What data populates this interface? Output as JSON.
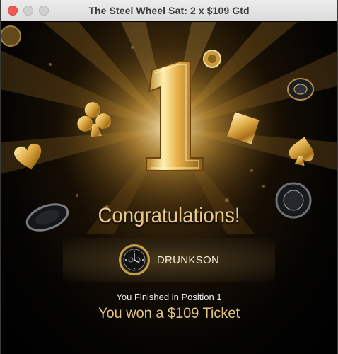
{
  "window": {
    "title": "The Steel Wheel Sat: 2 x $109 Gtd"
  },
  "award": {
    "position_badge": "1",
    "congrats_text": "Congratulations!",
    "player_name": "DRUNKSON",
    "finished_text": "You Finished in Position 1",
    "prize_text": "You won a $109 Ticket"
  },
  "colors": {
    "gold": "#e3c47e",
    "close_button": "#ee5a52"
  }
}
